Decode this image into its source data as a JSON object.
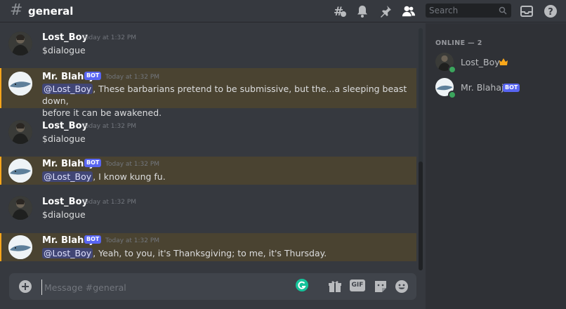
{
  "header": {
    "channel_name": "general",
    "search_placeholder": "Search"
  },
  "messages": [
    {
      "author": "Lost_Boy",
      "bot": false,
      "timestamp": "Today at 1:32 PM",
      "text": "$dialogue"
    },
    {
      "author": "Mr. Blahaj",
      "bot": true,
      "bot_label": "BOT",
      "timestamp": "Today at 1:32 PM",
      "mention": "@Lost_Boy",
      "text_line1": ", These barbarians pretend to be submissive, but the...a sleeping beast down,",
      "text_line2": "before it can be awakened."
    },
    {
      "author": "Lost_Boy",
      "bot": false,
      "timestamp": "Today at 1:32 PM",
      "text": "$dialogue"
    },
    {
      "author": "Mr. Blahaj",
      "bot": true,
      "bot_label": "BOT",
      "timestamp": "Today at 1:32 PM",
      "mention": "@Lost_Boy",
      "text": ", I know kung fu."
    },
    {
      "author": "Lost_Boy",
      "bot": false,
      "timestamp": "Today at 1:32 PM",
      "text": "$dialogue"
    },
    {
      "author": "Mr. Blahaj",
      "bot": true,
      "bot_label": "BOT",
      "timestamp": "Today at 1:32 PM",
      "mention": "@Lost_Boy",
      "text": ", Yeah, to you, it's Thanksgiving; to me, it's Thursday."
    }
  ],
  "composer": {
    "placeholder": "Message #general",
    "gif_label": "GIF"
  },
  "members": {
    "heading": "ONLINE — 2",
    "list": [
      {
        "name": "Lost_Boy",
        "status": "online",
        "owner": true
      },
      {
        "name": "Mr. Blahaj",
        "status": "online",
        "bot_label": "BOT"
      }
    ]
  },
  "colors": {
    "accent": "#5865f2",
    "mention_bg": "#4a4331",
    "online": "#3ba55d"
  }
}
